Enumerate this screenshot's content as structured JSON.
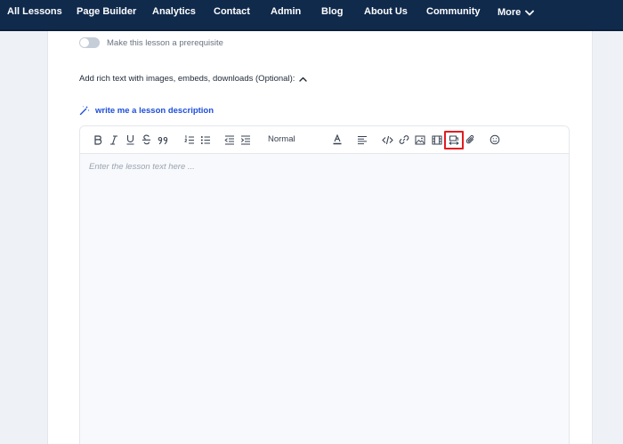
{
  "nav": {
    "items": [
      "All Lessons",
      "Page Builder",
      "Analytics",
      "Contact",
      "Admin",
      "Blog",
      "About Us",
      "Community"
    ],
    "more_label": "More"
  },
  "lesson": {
    "prerequisite_label": "Make this lesson a prerequisite",
    "prerequisite_on": false,
    "rich_text_label": "Add rich text with images, embeds, downloads (Optional):",
    "ai_link_label": "write me a lesson description"
  },
  "editor": {
    "heading_select": "Normal",
    "placeholder": "Enter the lesson text here ...",
    "toolbar_icons": [
      "bold-icon",
      "italic-icon",
      "underline-icon",
      "strikethrough-icon",
      "quote-icon",
      "ordered-list-icon",
      "bullet-list-icon",
      "outdent-icon",
      "indent-icon",
      "text-color-icon",
      "align-icon",
      "code-icon",
      "link-icon",
      "image-icon",
      "video-icon",
      "embed-icon",
      "attachment-icon",
      "emoji-icon"
    ],
    "highlighted_icon": "embed-icon"
  },
  "colors": {
    "nav_bg": "#102a4c",
    "link_blue": "#1d4ed8",
    "highlight_red": "#e11d21"
  }
}
